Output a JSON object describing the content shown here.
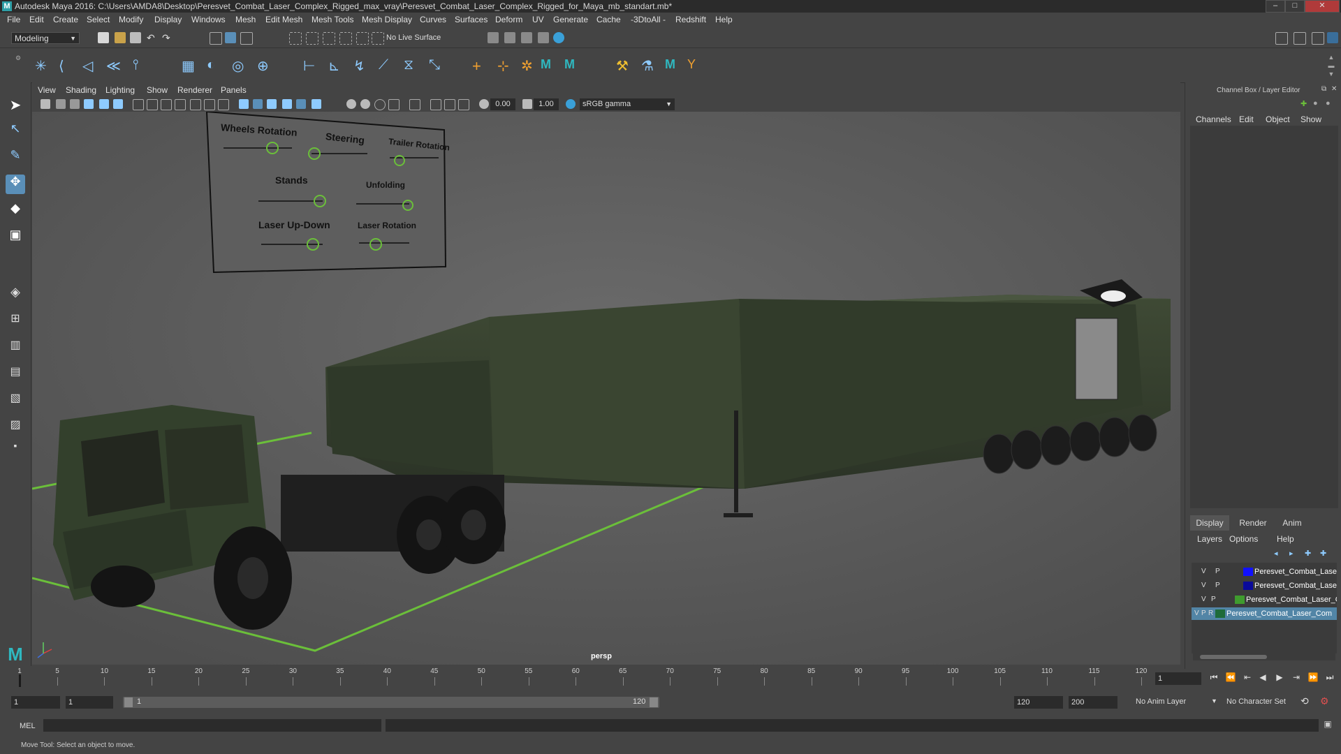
{
  "window": {
    "title": "Autodesk Maya 2016: C:\\Users\\AMDA8\\Desktop\\Peresvet_Combat_Laser_Complex_Rigged_max_vray\\Peresvet_Combat_Laser_Complex_Rigged_for_Maya_mb_standart.mb*",
    "logo": "M",
    "minimize": "–",
    "maximize": "□",
    "close": "✕"
  },
  "menubar": [
    "File",
    "Edit",
    "Create",
    "Select",
    "Modify",
    "Display",
    "Windows",
    "Mesh",
    "Edit Mesh",
    "Mesh Tools",
    "Mesh Display",
    "Curves",
    "Surfaces",
    "Deform",
    "UV",
    "Generate",
    "Cache",
    "-3DtoAll -",
    "Redshift",
    "Help"
  ],
  "statusline": {
    "mode": "Modeling",
    "live_surface": "No Live Surface"
  },
  "panel_menu": [
    "View",
    "Shading",
    "Lighting",
    "Show",
    "Renderer",
    "Panels"
  ],
  "panel_toolbar": {
    "exposure": "0.00",
    "gamma": "1.00",
    "color_space": "sRGB gamma"
  },
  "viewport": {
    "camera_label": "persp",
    "rig_panel": {
      "labels": [
        "Wheels Rotation",
        "Steering",
        "Trailer Rotation",
        "Stands",
        "Unfolding",
        "Laser Up-Down",
        "Laser Rotation"
      ]
    }
  },
  "channel_box": {
    "title": "Channel Box / Layer Editor",
    "menu": [
      "Channels",
      "Edit",
      "Object",
      "Show"
    ]
  },
  "layer_editor": {
    "tabs": [
      "Display",
      "Render",
      "Anim"
    ],
    "menu": [
      "Layers",
      "Options",
      "Help"
    ],
    "layers": [
      {
        "v": "V",
        "p": "P",
        "r": "",
        "name": "Peresvet_Combat_Laser",
        "color": "#1010ff"
      },
      {
        "v": "V",
        "p": "P",
        "r": "",
        "name": "Peresvet_Combat_Laser",
        "color": "#0a0a9a"
      },
      {
        "v": "V",
        "p": "P",
        "r": "",
        "name": "Peresvet_Combat_Laser_C",
        "color": "#3f9b2e"
      },
      {
        "v": "V",
        "p": "P",
        "r": "R",
        "name": "Peresvet_Combat_Laser_Com",
        "color": "#1e6b3a"
      }
    ]
  },
  "timeline": {
    "ticks": [
      "1",
      "5",
      "10",
      "15",
      "20",
      "25",
      "30",
      "35",
      "40",
      "45",
      "50",
      "55",
      "60",
      "65",
      "70",
      "75",
      "80",
      "85",
      "90",
      "95",
      "100",
      "105",
      "110",
      "115",
      "120"
    ],
    "current_frame": "1"
  },
  "range": {
    "start": "1",
    "playback_start": "1",
    "range_start_label": "1",
    "range_end_label": "120",
    "playback_end": "120",
    "end": "200",
    "anim_layer": "No Anim Layer",
    "character_set": "No Character Set"
  },
  "command_line": {
    "label": "MEL"
  },
  "help_line": "Move Tool: Select an object to move."
}
